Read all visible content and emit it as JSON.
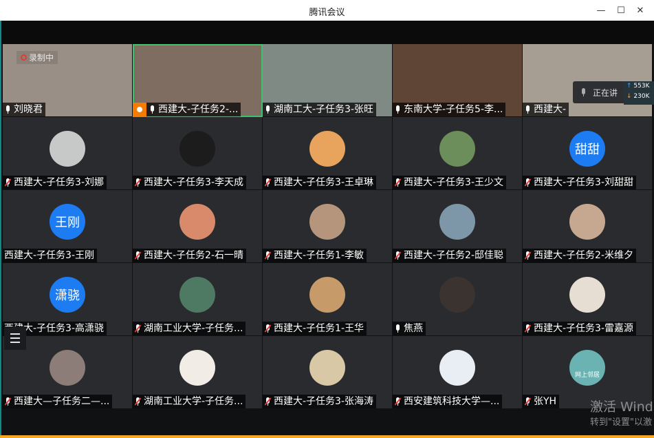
{
  "window": {
    "title": "腾讯会议"
  },
  "recording_label": "录制中",
  "talking_overlay": {
    "label": "正在讲"
  },
  "network": {
    "up": "553K",
    "down": "230K"
  },
  "watermark": {
    "line1": "激活 Wind",
    "line2": "转到\"设置\"以激"
  },
  "participants": [
    {
      "name": "刘晓君",
      "kind": "video",
      "bg": "#9a8f86",
      "mic": "on",
      "recording": true
    },
    {
      "name": "西建大-子任务2-...",
      "kind": "video",
      "bg": "#7e6d60",
      "mic": "on",
      "host": true,
      "active": true
    },
    {
      "name": "湖南工大-子任务3-张旺",
      "kind": "video",
      "bg": "#7f8a85",
      "mic": "on"
    },
    {
      "name": "东南大学-子任务5-李...",
      "kind": "video",
      "bg": "#5e4536",
      "mic": "on"
    },
    {
      "name": "西建大-",
      "kind": "video",
      "bg": "#a69d93",
      "mic": "on"
    },
    {
      "name": "西建大-子任务3-刘娜",
      "kind": "avatar",
      "avatar_color": "#c7c9c8",
      "mic": "muted"
    },
    {
      "name": "西建大-子任务3-李天成",
      "kind": "avatar",
      "avatar_color": "#1c1c1c",
      "mic": "muted"
    },
    {
      "name": "西建大-子任务3-王卓琳",
      "kind": "avatar",
      "avatar_color": "#e8a35c",
      "mic": "muted"
    },
    {
      "name": "西建大-子任务3-王少文",
      "kind": "avatar",
      "avatar_color": "#6b8e5a",
      "mic": "muted"
    },
    {
      "name": "西建大-子任务3-刘甜甜",
      "kind": "text",
      "avatar_text": "甜甜",
      "mic": "muted"
    },
    {
      "name": "西建大-子任务3-王刚",
      "kind": "text",
      "avatar_text": "王刚",
      "mic": "none"
    },
    {
      "name": "西建大-子任务2-石一晴",
      "kind": "avatar",
      "avatar_color": "#d98a6a",
      "mic": "muted"
    },
    {
      "name": "西建大-子任务1-李敏",
      "kind": "avatar",
      "avatar_color": "#b6957d",
      "mic": "muted"
    },
    {
      "name": "西建大-子任务2-邸佳聪",
      "kind": "avatar",
      "avatar_color": "#7e97a8",
      "mic": "muted"
    },
    {
      "name": "西建大-子任务2-米维夕",
      "kind": "avatar",
      "avatar_color": "#c6a890",
      "mic": "muted"
    },
    {
      "name": "西建大-子任务3-高潇骁",
      "kind": "text",
      "avatar_text": "潇骁",
      "mic": "none"
    },
    {
      "name": "湖南工业大学-子任务...",
      "kind": "avatar",
      "avatar_color": "#4e7a64",
      "mic": "muted"
    },
    {
      "name": "西建大-子任务1-王华",
      "kind": "avatar",
      "avatar_color": "#c79a6a",
      "mic": "muted"
    },
    {
      "name": "焦燕",
      "kind": "avatar",
      "avatar_color": "#3b3330",
      "mic": "on"
    },
    {
      "name": "西建大-子任务3-雷嘉源",
      "kind": "avatar",
      "avatar_color": "#e6ddd3",
      "mic": "muted"
    },
    {
      "name": "西建大—子任务二—...",
      "kind": "avatar",
      "avatar_color": "#8c7d78",
      "mic": "muted"
    },
    {
      "name": "湖南工业大学-子任务...",
      "kind": "avatar",
      "avatar_color": "#f1ede6",
      "mic": "muted"
    },
    {
      "name": "西建大-子任务3-张海涛",
      "kind": "avatar",
      "avatar_color": "#d9c8a5",
      "mic": "muted"
    },
    {
      "name": "西安建筑科技大学—...",
      "kind": "avatar",
      "avatar_color": "#e8eef3",
      "mic": "muted"
    },
    {
      "name": "张YH",
      "kind": "avatar",
      "avatar_color": "#6ab3b2",
      "avatar_label": "网上邻居",
      "mic": "muted"
    }
  ]
}
